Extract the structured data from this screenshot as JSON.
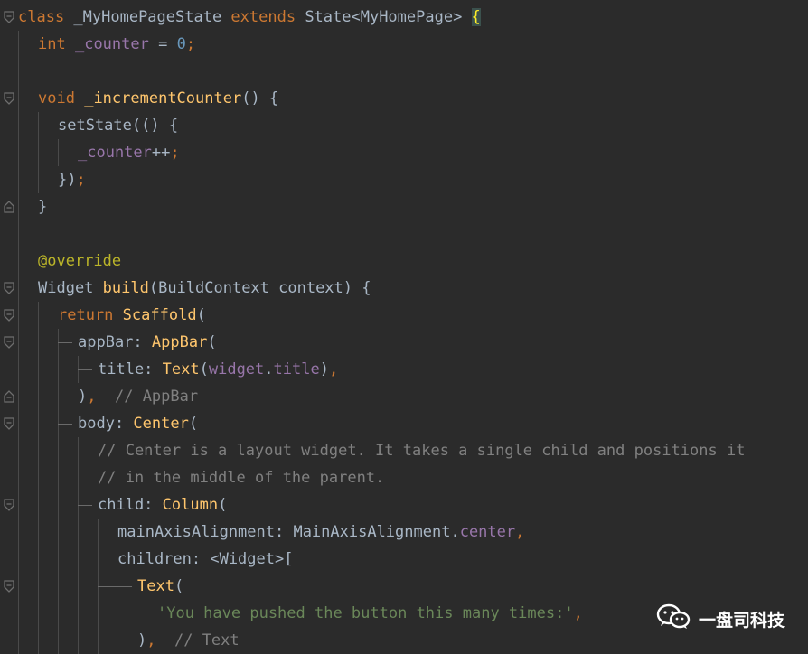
{
  "editor": {
    "theme": {
      "background": "#2b2b2b",
      "keyword": "#cc7832",
      "function": "#ffc66d",
      "field": "#9876aa",
      "number": "#6897bb",
      "string": "#6a8759",
      "comment": "#808080",
      "annotation": "#bbb529",
      "default": "#a9b7c6"
    },
    "lines": [
      {
        "tokens": [
          {
            "t": "class",
            "c": "kw"
          },
          {
            "t": " _MyHomePageState "
          },
          {
            "t": "extends",
            "c": "kw"
          },
          {
            "t": " State<MyHomePage> "
          },
          {
            "t": "{",
            "c": "hl"
          }
        ]
      },
      {
        "tokens": [
          {
            "t": "int",
            "c": "kw"
          },
          {
            "t": " "
          },
          {
            "t": "_counter",
            "c": "fld"
          },
          {
            "t": " = "
          },
          {
            "t": "0",
            "c": "num"
          },
          {
            "t": ";",
            "c": "kw"
          }
        ]
      },
      {
        "tokens": []
      },
      {
        "tokens": [
          {
            "t": "void",
            "c": "kw"
          },
          {
            "t": " "
          },
          {
            "t": "_incrementCounter",
            "c": "fn"
          },
          {
            "t": "() {"
          }
        ]
      },
      {
        "tokens": [
          {
            "t": "setState(() {"
          }
        ]
      },
      {
        "tokens": [
          {
            "t": "_counter",
            "c": "fld"
          },
          {
            "t": "++"
          },
          {
            "t": ";",
            "c": "kw"
          }
        ]
      },
      {
        "tokens": [
          {
            "t": "})"
          },
          {
            "t": ";",
            "c": "kw"
          }
        ]
      },
      {
        "tokens": [
          {
            "t": "}"
          }
        ]
      },
      {
        "tokens": []
      },
      {
        "tokens": [
          {
            "t": "@override",
            "c": "ann"
          }
        ]
      },
      {
        "tokens": [
          {
            "t": "Widget "
          },
          {
            "t": "build",
            "c": "fn"
          },
          {
            "t": "(BuildContext context) {"
          }
        ]
      },
      {
        "tokens": [
          {
            "t": "return",
            "c": "kw"
          },
          {
            "t": " "
          },
          {
            "t": "Scaffold",
            "c": "fn"
          },
          {
            "t": "("
          }
        ]
      },
      {
        "tokens": [
          {
            "t": "appBar: "
          },
          {
            "t": "AppBar",
            "c": "fn"
          },
          {
            "t": "("
          }
        ]
      },
      {
        "tokens": [
          {
            "t": "title: "
          },
          {
            "t": "Text",
            "c": "fn"
          },
          {
            "t": "("
          },
          {
            "t": "widget",
            "c": "fld"
          },
          {
            "t": "."
          },
          {
            "t": "title",
            "c": "fld"
          },
          {
            "t": ")"
          },
          {
            "t": ",",
            "c": "kw"
          }
        ]
      },
      {
        "tokens": [
          {
            "t": ")"
          },
          {
            "t": ",",
            "c": "kw"
          },
          {
            "t": "  "
          },
          {
            "t": "// AppBar",
            "c": "cmt"
          }
        ]
      },
      {
        "tokens": [
          {
            "t": "body: "
          },
          {
            "t": "Center",
            "c": "fn"
          },
          {
            "t": "("
          }
        ]
      },
      {
        "tokens": [
          {
            "t": "// Center is a layout widget. It takes a single child and positions it",
            "c": "cmt"
          }
        ]
      },
      {
        "tokens": [
          {
            "t": "// in the middle of the parent.",
            "c": "cmt"
          }
        ]
      },
      {
        "tokens": [
          {
            "t": "child: "
          },
          {
            "t": "Column",
            "c": "fn"
          },
          {
            "t": "("
          }
        ]
      },
      {
        "tokens": [
          {
            "t": "mainAxisAlignment: MainAxisAlignment."
          },
          {
            "t": "center",
            "c": "fld"
          },
          {
            "t": ",",
            "c": "kw"
          }
        ]
      },
      {
        "tokens": [
          {
            "t": "children: <Widget>["
          }
        ]
      },
      {
        "tokens": [
          {
            "t": "Text",
            "c": "fn"
          },
          {
            "t": "("
          }
        ]
      },
      {
        "tokens": [
          {
            "t": "'You have pushed the button this many times:'",
            "c": "str"
          },
          {
            "t": ",",
            "c": "kw"
          }
        ]
      },
      {
        "tokens": [
          {
            "t": ")"
          },
          {
            "t": ",",
            "c": "kw"
          },
          {
            "t": "  "
          },
          {
            "t": "// Text",
            "c": "cmt"
          }
        ]
      }
    ]
  },
  "watermark": {
    "text": "一盘司科技",
    "icon": "wechat-icon"
  }
}
